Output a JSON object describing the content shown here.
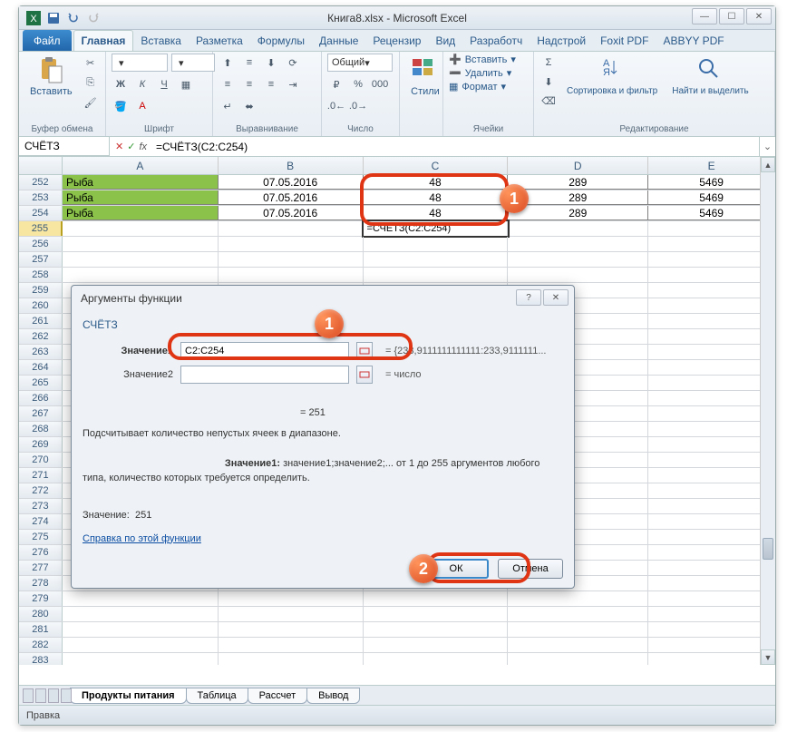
{
  "app": {
    "title": "Книга8.xlsx - Microsoft Excel"
  },
  "tabs": {
    "file": "Файл",
    "items": [
      "Главная",
      "Вставка",
      "Разметка",
      "Формулы",
      "Данные",
      "Рецензир",
      "Вид",
      "Разработч",
      "Надстрой",
      "Foxit PDF",
      "ABBYY PDF"
    ],
    "active": 0
  },
  "ribbon": {
    "paste": "Вставить",
    "clipboard": "Буфер обмена",
    "font": "Шрифт",
    "align": "Выравнивание",
    "number_group": "Число",
    "number_format": "Общий",
    "styles": "Стили",
    "insert": "Вставить",
    "delete": "Удалить",
    "format": "Формат",
    "cells": "Ячейки",
    "sort_filter": "Сортировка и фильтр",
    "find_select": "Найти и выделить",
    "editing": "Редактирование"
  },
  "formula_bar": {
    "name_box": "СЧЁТЗ",
    "formula": "=СЧЁТЗ(C2:C254)"
  },
  "grid": {
    "col_widths": {
      "A": 172,
      "B": 160,
      "C": 160,
      "D": 155,
      "E": 140
    },
    "cols": [
      "A",
      "B",
      "C",
      "D",
      "E"
    ],
    "rows": [
      {
        "n": 252,
        "a": "Рыба",
        "b": "07.05.2016",
        "c": "48",
        "d": "289",
        "e": "5469"
      },
      {
        "n": 253,
        "a": "Рыба",
        "b": "07.05.2016",
        "c": "48",
        "d": "289",
        "e": "5469"
      },
      {
        "n": 254,
        "a": "Рыба",
        "b": "07.05.2016",
        "c": "48",
        "d": "289",
        "e": "5469"
      }
    ],
    "edit_row": 255,
    "edit_cell_text": "=СЧЁТЗ(C2:C254)",
    "empty_rows": [
      256,
      257,
      258,
      259,
      260,
      261,
      262,
      263,
      264,
      265,
      266,
      267,
      268,
      269,
      270,
      271,
      272,
      273,
      274,
      275,
      276,
      277,
      278,
      279,
      280,
      281,
      282,
      283
    ]
  },
  "dialog": {
    "title": "Аргументы функции",
    "func": "СЧЁТЗ",
    "arg1_label": "Значение1",
    "arg1_value": "C2:C254",
    "arg1_out": "{233,9111111111111:233,9111111...",
    "arg2_label": "Значение2",
    "arg2_out": "число",
    "result_eq": "= 251",
    "description": "Подсчитывает количество непустых ячеек в диапазоне.",
    "arg_desc_label": "Значение1:",
    "arg_desc_text": "значение1;значение2;... от 1 до 255 аргументов любого типа, количество которых требуется определить.",
    "value_label": "Значение:",
    "value": "251",
    "help": "Справка по этой функции",
    "ok": "ОК",
    "cancel": "Отмена"
  },
  "sheets": {
    "items": [
      "Продукты питания",
      "Таблица",
      "Рассчет",
      "Вывод"
    ],
    "active": 0
  },
  "status": {
    "text": "Правка"
  },
  "annotations": {
    "badge1": "1",
    "badge2": "2"
  }
}
